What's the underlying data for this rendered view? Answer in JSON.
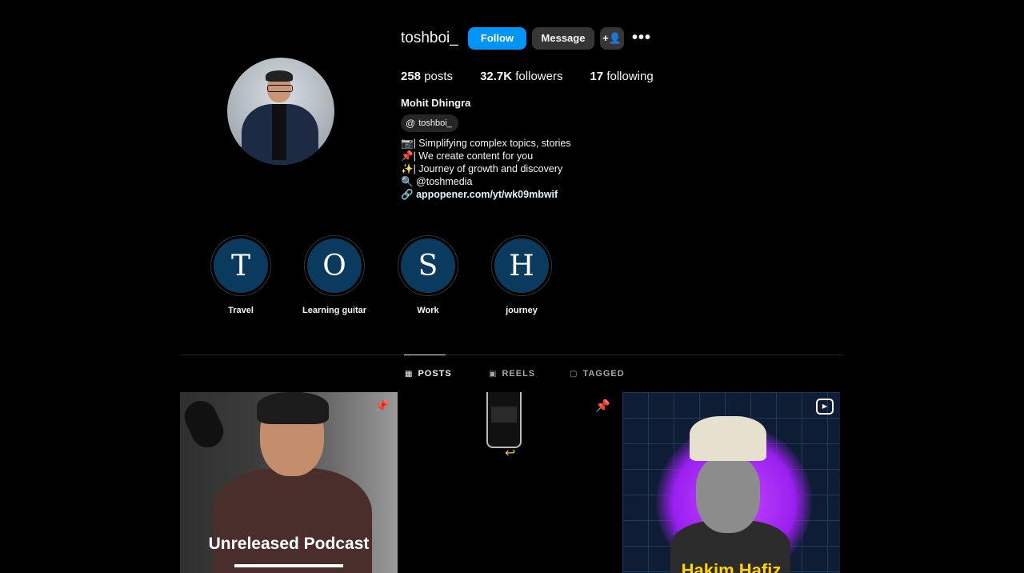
{
  "profile": {
    "username": "toshboi_",
    "follow_label": "Follow",
    "message_label": "Message",
    "add_user_icon": "+👤",
    "more_icon": "•••",
    "stats": {
      "posts_count": "258",
      "posts_label": "posts",
      "followers_count": "32.7K",
      "followers_label": "followers",
      "following_count": "17",
      "following_label": "following"
    },
    "full_name": "Mohit Dhingra",
    "threads_handle": "toshboi_",
    "bio": [
      "📷| Simplifying complex topics, stories",
      "📌| We create content for you",
      "✨| Journey of growth and discovery",
      "🔍  @toshmedia"
    ],
    "link": "appopener.com/yt/wk09mbwif"
  },
  "highlights": [
    {
      "letter": "T",
      "label": "Travel"
    },
    {
      "letter": "O",
      "label": "Learning guitar"
    },
    {
      "letter": "S",
      "label": "Work"
    },
    {
      "letter": "H",
      "label": "journey"
    }
  ],
  "tabs": {
    "posts": "POSTS",
    "reels": "REELS",
    "tagged": "TAGGED"
  },
  "posts": {
    "post1_caption": "Unreleased Podcast",
    "post3_caption": "Hakim Hafiz"
  },
  "colors": {
    "background": "#000000",
    "follow_button": "#0095f6",
    "secondary_button": "#363636",
    "highlight_circle": "#0a3b5e"
  }
}
